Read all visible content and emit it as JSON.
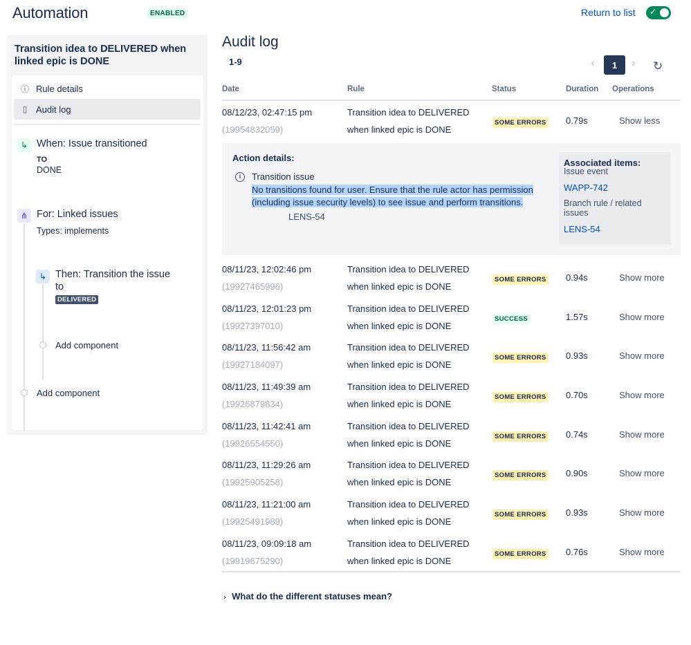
{
  "header": {
    "title": "Automation",
    "status": "ENABLED",
    "return_link": "Return to list",
    "toggle_on": true
  },
  "sidebar": {
    "rule_name": "Transition idea to DELIVERED when linked epic is DONE",
    "nav": [
      {
        "label": "Rule details",
        "icon": "info-icon"
      },
      {
        "label": "Audit log",
        "icon": "document-icon"
      }
    ],
    "trigger": {
      "title": "When: Issue transitioned",
      "to_label": "TO",
      "to_value": "DONE",
      "icon": "trigger-icon"
    },
    "branch": {
      "title": "For: Linked issues",
      "types": "Types: implements",
      "icon": "branch-icon"
    },
    "action": {
      "title_line1": "Then: Transition the issue",
      "title_line2": "to",
      "status": "DELIVERED",
      "icon": "transition-icon"
    },
    "add_component_inner": "Add component",
    "add_component_outer": "Add component"
  },
  "main": {
    "title": "Audit log",
    "range": "1-9",
    "page": "1",
    "columns": [
      "Date",
      "Rule",
      "Status",
      "Duration",
      "Operations"
    ],
    "rows": [
      {
        "date": "08/12/23, 02:47:15 pm",
        "id": "(19954832059)",
        "rule1": "Transition idea to DELIVERED",
        "rule2": "when linked epic is DONE",
        "status": "SOME ERRORS",
        "duration": "0.79s",
        "op": "Show less"
      },
      {
        "date": "08/11/23, 12:02:46 pm",
        "id": "(19927465996)",
        "rule1": "Transition idea to DELIVERED",
        "rule2": "when linked epic is DONE",
        "status": "SOME ERRORS",
        "duration": "0.94s",
        "op": "Show more"
      },
      {
        "date": "08/11/23, 12:01:23 pm",
        "id": "(19927397010)",
        "rule1": "Transition idea to DELIVERED",
        "rule2": "when linked epic is DONE",
        "status": "SUCCESS",
        "duration": "1.57s",
        "op": "Show more"
      },
      {
        "date": "08/11/23, 11:56:42 am",
        "id": "(19927184097)",
        "rule1": "Transition idea to DELIVERED",
        "rule2": "when linked epic is DONE",
        "status": "SOME ERRORS",
        "duration": "0.93s",
        "op": "Show more"
      },
      {
        "date": "08/11/23, 11:49:39 am",
        "id": "(19926879834)",
        "rule1": "Transition idea to DELIVERED",
        "rule2": "when linked epic is DONE",
        "status": "SOME ERRORS",
        "duration": "0.70s",
        "op": "Show more"
      },
      {
        "date": "08/11/23, 11:42:41 am",
        "id": "(19926554550)",
        "rule1": "Transition idea to DELIVERED",
        "rule2": "when linked epic is DONE",
        "status": "SOME ERRORS",
        "duration": "0.74s",
        "op": "Show more"
      },
      {
        "date": "08/11/23, 11:29:26 am",
        "id": "(19925905258)",
        "rule1": "Transition idea to DELIVERED",
        "rule2": "when linked epic is DONE",
        "status": "SOME ERRORS",
        "duration": "0.90s",
        "op": "Show more"
      },
      {
        "date": "08/11/23, 11:21:00 am",
        "id": "(19925491989)",
        "rule1": "Transition idea to DELIVERED",
        "rule2": "when linked epic is DONE",
        "status": "SOME ERRORS",
        "duration": "0.93s",
        "op": "Show more"
      },
      {
        "date": "08/11/23, 09:09:18 am",
        "id": "(19919675290)",
        "rule1": "Transition idea to DELIVERED",
        "rule2": "when linked epic is DONE",
        "status": "SOME ERRORS",
        "duration": "0.76s",
        "op": "Show more"
      }
    ],
    "details": {
      "title": "Action details:",
      "action": "Transition issue",
      "message": "No transitions found for user. Ensure that the rule actor has permission (including issue security levels) to see issue and perform transitions.",
      "issue": "LENS-54",
      "associated_title": "Associated items:",
      "issue_event": "Issue event",
      "issue_event_link": "WAPP-742",
      "branch_label": "Branch rule / related issues",
      "branch_link": "LENS-54"
    },
    "faq": "What do the different statuses mean?"
  },
  "colors": {
    "brand_blue": "#0052cc",
    "success_green": "#00875a",
    "error_yellow": "#fff0b3",
    "success_bg": "#e3fcef",
    "dark_navy": "#253858"
  }
}
